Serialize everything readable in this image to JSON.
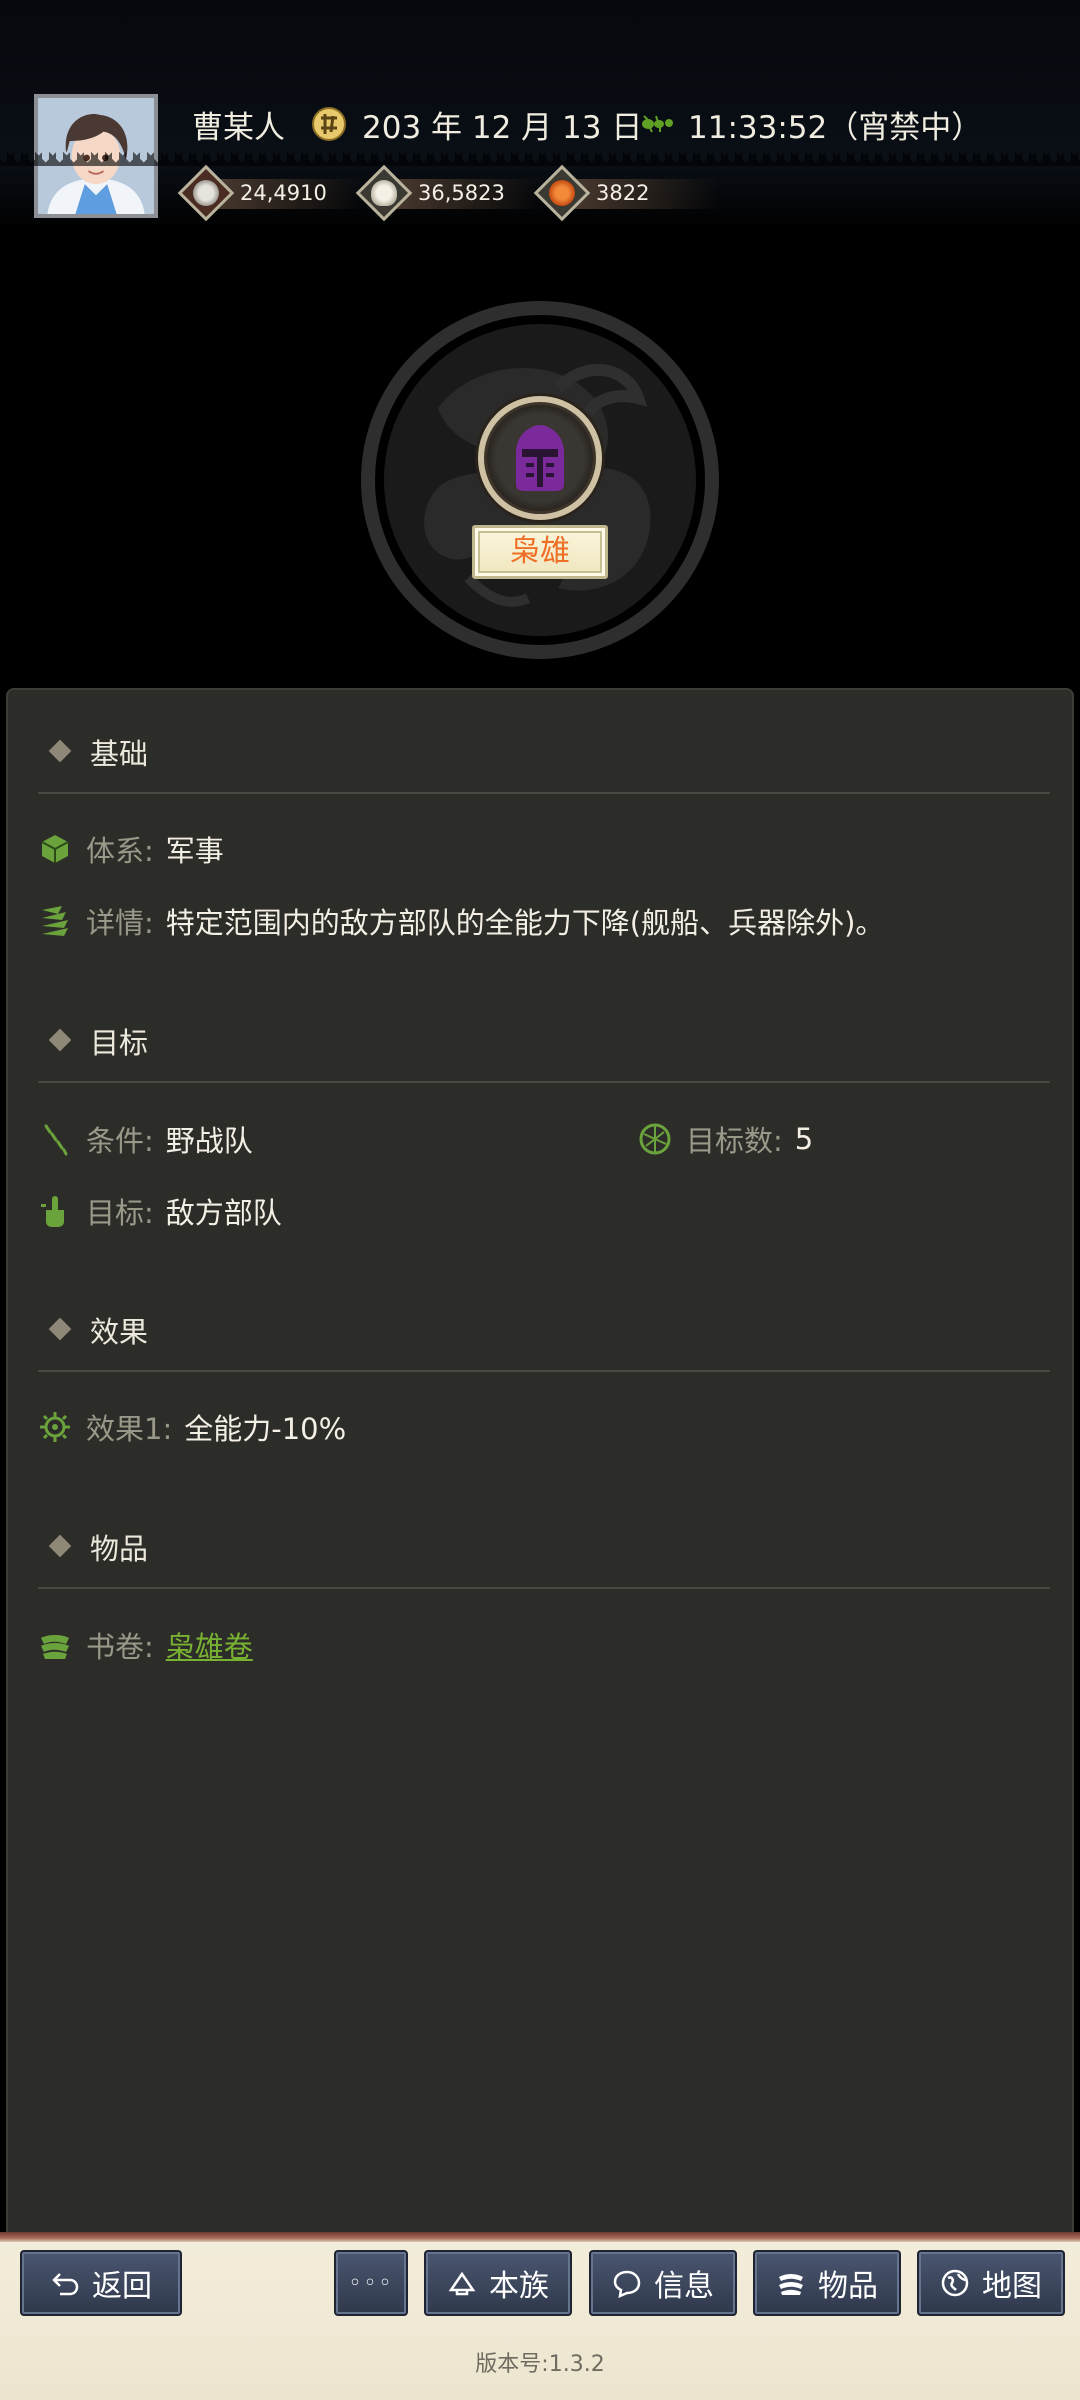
{
  "header": {
    "player_name": "曹某人",
    "date": "203 年 12 月 13 日",
    "time": "11:33:52（宵禁中）",
    "resources": [
      {
        "icon": "silver-coin-icon",
        "value": "24,4910"
      },
      {
        "icon": "rice-bowl-icon",
        "value": "36,5823"
      },
      {
        "icon": "orange-medal-icon",
        "value": "3822"
      }
    ]
  },
  "skill": {
    "name": "枭雄",
    "icon": "purple-helmet-icon"
  },
  "sections": {
    "basic": {
      "title": "基础",
      "system_label": "体系:",
      "system_value": "军事",
      "detail_label": "详情:",
      "detail_value": "特定范围内的敌方部队的全能力下降(舰船、兵器除外)。"
    },
    "target": {
      "title": "目标",
      "condition_label": "条件:",
      "condition_value": "野战队",
      "count_label": "目标数:",
      "count_value": "5",
      "target_label": "目标:",
      "target_value": "敌方部队"
    },
    "effect": {
      "title": "效果",
      "effect1_label": "效果1:",
      "effect1_value": "全能力-10%"
    },
    "items": {
      "title": "物品",
      "book_label": "书卷:",
      "book_value": "枭雄卷"
    }
  },
  "bottom_bar": {
    "back": "返回",
    "more": "◦◦◦",
    "clan": "本族",
    "info": "信息",
    "items": "物品",
    "map": "地图",
    "version": "版本号:1.3.2"
  },
  "colors": {
    "panel_bg": "#2c2c28",
    "link_green": "#79b233",
    "skill_name_orange": "#ee6e25",
    "button_blue": "#3a4560"
  }
}
